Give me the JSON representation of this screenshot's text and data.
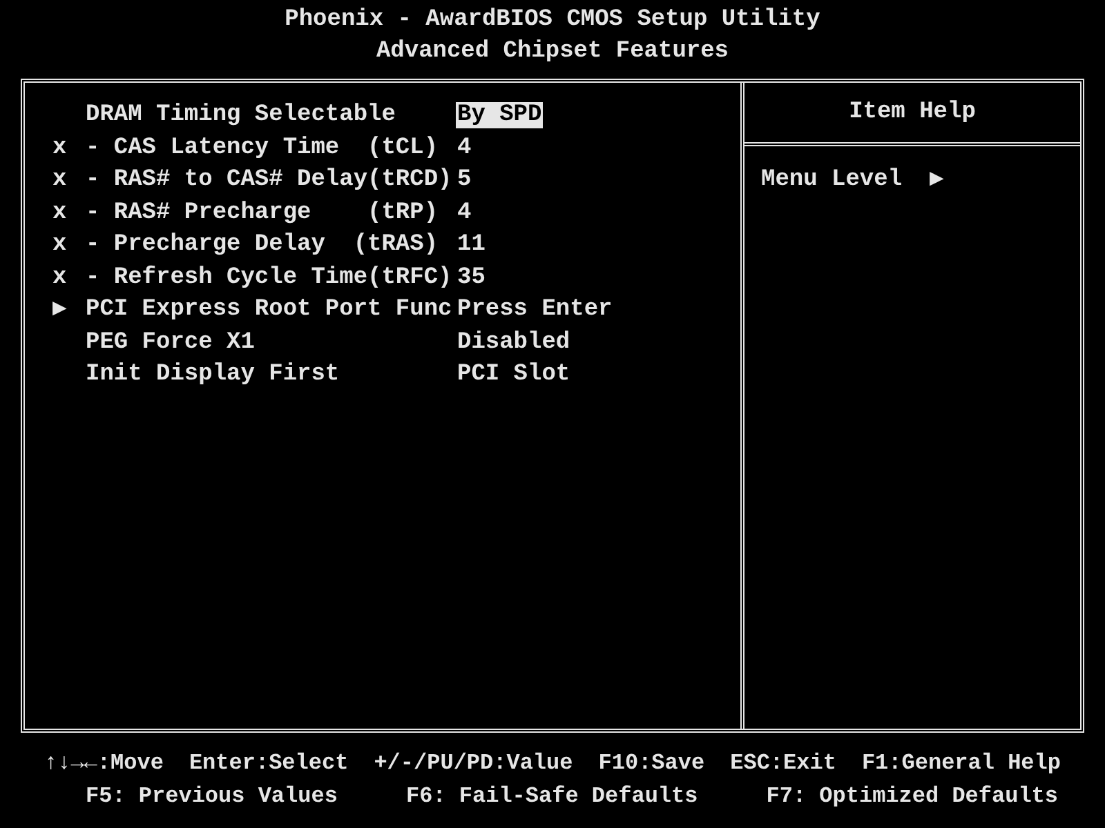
{
  "header": {
    "title": "Phoenix - AwardBIOS CMOS Setup Utility",
    "subtitle": "Advanced Chipset Features"
  },
  "items": [
    {
      "marker": "",
      "label": "DRAM Timing Selectable",
      "value": "By SPD",
      "selected": true
    },
    {
      "marker": "x",
      "label": "- CAS Latency Time  (tCL)",
      "value": "4",
      "selected": false
    },
    {
      "marker": "x",
      "label": "- RAS# to CAS# Delay(tRCD)",
      "value": "5",
      "selected": false
    },
    {
      "marker": "x",
      "label": "- RAS# Precharge    (tRP)",
      "value": "4",
      "selected": false
    },
    {
      "marker": "x",
      "label": "- Precharge Delay  (tRAS)",
      "value": "11",
      "selected": false
    },
    {
      "marker": "x",
      "label": "- Refresh Cycle Time(tRFC)",
      "value": "35",
      "selected": false
    },
    {
      "marker": "▶",
      "label": "PCI Express Root Port Func",
      "value": "Press Enter",
      "selected": false
    },
    {
      "marker": "",
      "label": "PEG Force X1",
      "value": "Disabled",
      "selected": false
    },
    {
      "marker": "",
      "label": "Init Display First",
      "value": "PCI Slot",
      "selected": false
    }
  ],
  "help": {
    "title": "Item Help",
    "menu_level_label": "Menu Level",
    "menu_level_marker": "▶"
  },
  "footer": [
    [
      "↑↓→←:Move",
      "Enter:Select",
      "+/-/PU/PD:Value",
      "F10:Save",
      "ESC:Exit",
      "F1:General Help"
    ],
    [
      "F5: Previous Values",
      "F6: Fail-Safe Defaults",
      "F7: Optimized Defaults"
    ]
  ]
}
